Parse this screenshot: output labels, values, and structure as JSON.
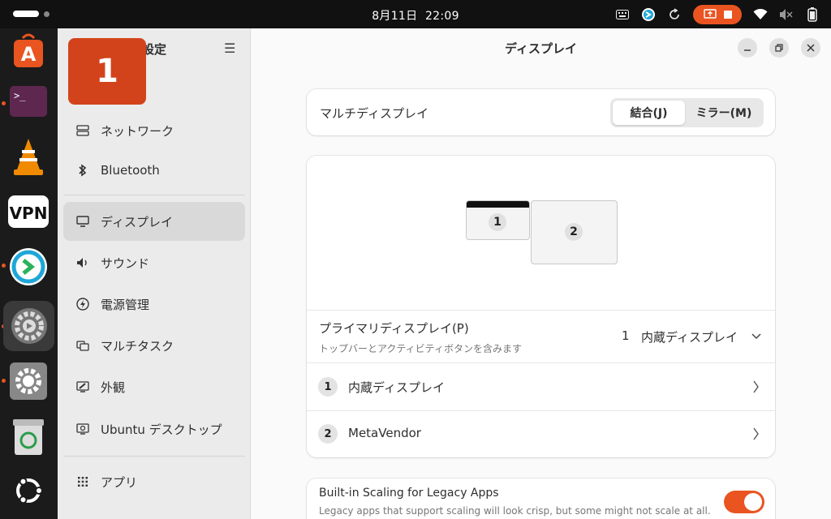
{
  "topbar": {
    "clock_date": "8月11日",
    "clock_time": "22:09",
    "tray_icons": [
      "keyboard-icon",
      "remote-desktop-icon",
      "refresh-icon",
      "screen-record-icon",
      "stop-icon",
      "wifi-icon",
      "volume-muted-icon",
      "battery-icon"
    ]
  },
  "dock": {
    "items": [
      {
        "name": "app-center-icon",
        "label": "A"
      },
      {
        "name": "terminal-icon",
        "label": ">_"
      },
      {
        "name": "vlc-icon",
        "label": ""
      },
      {
        "name": "vpn-icon",
        "label": "VPN"
      },
      {
        "name": "remote-desktop-app-icon",
        "label": ""
      },
      {
        "name": "settings-app-icon",
        "label": ""
      },
      {
        "name": "settings-gear-icon",
        "label": ""
      },
      {
        "name": "trash-icon",
        "label": ""
      },
      {
        "name": "ubuntu-logo-icon",
        "label": ""
      }
    ]
  },
  "badge": {
    "text": "1"
  },
  "sidebar": {
    "title": "設定",
    "items": [
      {
        "label": "ネットワーク",
        "icon": "network-icon"
      },
      {
        "label": "Bluetooth",
        "icon": "bluetooth-icon"
      },
      {
        "label": "ディスプレイ",
        "icon": "display-icon"
      },
      {
        "label": "サウンド",
        "icon": "sound-icon"
      },
      {
        "label": "電源管理",
        "icon": "power-icon"
      },
      {
        "label": "マルチタスク",
        "icon": "multitask-icon"
      },
      {
        "label": "外観",
        "icon": "appearance-icon"
      },
      {
        "label": "Ubuntu デスクトップ",
        "icon": "ubuntu-desktop-icon"
      },
      {
        "label": "アプリ",
        "icon": "apps-icon"
      }
    ],
    "selected": "ディスプレイ"
  },
  "main": {
    "title": "ディスプレイ",
    "multi_display": {
      "label": "マルチディスプレイ",
      "join": "結合(J)",
      "mirror": "ミラー(M)",
      "selected": "結合(J)"
    },
    "arrangement": {
      "monitors": [
        {
          "number": "1"
        },
        {
          "number": "2"
        }
      ]
    },
    "primary": {
      "label": "プライマリディスプレイ(P)",
      "sub": "トップバーとアクティビティボタンを含みます",
      "value_num": "1",
      "value_name": "内蔵ディスプレイ"
    },
    "displays": [
      {
        "num": "1",
        "name": "内蔵ディスプレイ"
      },
      {
        "num": "2",
        "name": "MetaVendor"
      }
    ],
    "scaling": {
      "label": "Built-in Scaling for Legacy Apps",
      "sub": "Legacy apps that support scaling will look crisp, but some might not scale at all.",
      "enabled": true
    }
  },
  "colors": {
    "accent": "#e95420",
    "badge": "#d2431b"
  }
}
